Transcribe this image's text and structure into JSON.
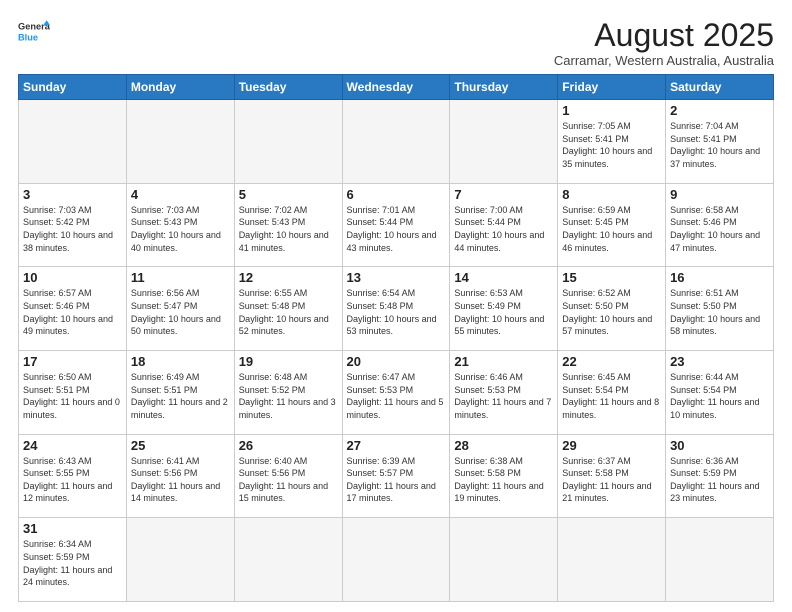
{
  "header": {
    "logo_general": "General",
    "logo_blue": "Blue",
    "month_title": "August 2025",
    "location": "Carramar, Western Australia, Australia"
  },
  "weekdays": [
    "Sunday",
    "Monday",
    "Tuesday",
    "Wednesday",
    "Thursday",
    "Friday",
    "Saturday"
  ],
  "weeks": [
    [
      {
        "day": "",
        "info": ""
      },
      {
        "day": "",
        "info": ""
      },
      {
        "day": "",
        "info": ""
      },
      {
        "day": "",
        "info": ""
      },
      {
        "day": "",
        "info": ""
      },
      {
        "day": "1",
        "info": "Sunrise: 7:05 AM\nSunset: 5:41 PM\nDaylight: 10 hours\nand 35 minutes."
      },
      {
        "day": "2",
        "info": "Sunrise: 7:04 AM\nSunset: 5:41 PM\nDaylight: 10 hours\nand 37 minutes."
      }
    ],
    [
      {
        "day": "3",
        "info": "Sunrise: 7:03 AM\nSunset: 5:42 PM\nDaylight: 10 hours\nand 38 minutes."
      },
      {
        "day": "4",
        "info": "Sunrise: 7:03 AM\nSunset: 5:43 PM\nDaylight: 10 hours\nand 40 minutes."
      },
      {
        "day": "5",
        "info": "Sunrise: 7:02 AM\nSunset: 5:43 PM\nDaylight: 10 hours\nand 41 minutes."
      },
      {
        "day": "6",
        "info": "Sunrise: 7:01 AM\nSunset: 5:44 PM\nDaylight: 10 hours\nand 43 minutes."
      },
      {
        "day": "7",
        "info": "Sunrise: 7:00 AM\nSunset: 5:44 PM\nDaylight: 10 hours\nand 44 minutes."
      },
      {
        "day": "8",
        "info": "Sunrise: 6:59 AM\nSunset: 5:45 PM\nDaylight: 10 hours\nand 46 minutes."
      },
      {
        "day": "9",
        "info": "Sunrise: 6:58 AM\nSunset: 5:46 PM\nDaylight: 10 hours\nand 47 minutes."
      }
    ],
    [
      {
        "day": "10",
        "info": "Sunrise: 6:57 AM\nSunset: 5:46 PM\nDaylight: 10 hours\nand 49 minutes."
      },
      {
        "day": "11",
        "info": "Sunrise: 6:56 AM\nSunset: 5:47 PM\nDaylight: 10 hours\nand 50 minutes."
      },
      {
        "day": "12",
        "info": "Sunrise: 6:55 AM\nSunset: 5:48 PM\nDaylight: 10 hours\nand 52 minutes."
      },
      {
        "day": "13",
        "info": "Sunrise: 6:54 AM\nSunset: 5:48 PM\nDaylight: 10 hours\nand 53 minutes."
      },
      {
        "day": "14",
        "info": "Sunrise: 6:53 AM\nSunset: 5:49 PM\nDaylight: 10 hours\nand 55 minutes."
      },
      {
        "day": "15",
        "info": "Sunrise: 6:52 AM\nSunset: 5:50 PM\nDaylight: 10 hours\nand 57 minutes."
      },
      {
        "day": "16",
        "info": "Sunrise: 6:51 AM\nSunset: 5:50 PM\nDaylight: 10 hours\nand 58 minutes."
      }
    ],
    [
      {
        "day": "17",
        "info": "Sunrise: 6:50 AM\nSunset: 5:51 PM\nDaylight: 11 hours\nand 0 minutes."
      },
      {
        "day": "18",
        "info": "Sunrise: 6:49 AM\nSunset: 5:51 PM\nDaylight: 11 hours\nand 2 minutes."
      },
      {
        "day": "19",
        "info": "Sunrise: 6:48 AM\nSunset: 5:52 PM\nDaylight: 11 hours\nand 3 minutes."
      },
      {
        "day": "20",
        "info": "Sunrise: 6:47 AM\nSunset: 5:53 PM\nDaylight: 11 hours\nand 5 minutes."
      },
      {
        "day": "21",
        "info": "Sunrise: 6:46 AM\nSunset: 5:53 PM\nDaylight: 11 hours\nand 7 minutes."
      },
      {
        "day": "22",
        "info": "Sunrise: 6:45 AM\nSunset: 5:54 PM\nDaylight: 11 hours\nand 8 minutes."
      },
      {
        "day": "23",
        "info": "Sunrise: 6:44 AM\nSunset: 5:54 PM\nDaylight: 11 hours\nand 10 minutes."
      }
    ],
    [
      {
        "day": "24",
        "info": "Sunrise: 6:43 AM\nSunset: 5:55 PM\nDaylight: 11 hours\nand 12 minutes."
      },
      {
        "day": "25",
        "info": "Sunrise: 6:41 AM\nSunset: 5:56 PM\nDaylight: 11 hours\nand 14 minutes."
      },
      {
        "day": "26",
        "info": "Sunrise: 6:40 AM\nSunset: 5:56 PM\nDaylight: 11 hours\nand 15 minutes."
      },
      {
        "day": "27",
        "info": "Sunrise: 6:39 AM\nSunset: 5:57 PM\nDaylight: 11 hours\nand 17 minutes."
      },
      {
        "day": "28",
        "info": "Sunrise: 6:38 AM\nSunset: 5:58 PM\nDaylight: 11 hours\nand 19 minutes."
      },
      {
        "day": "29",
        "info": "Sunrise: 6:37 AM\nSunset: 5:58 PM\nDaylight: 11 hours\nand 21 minutes."
      },
      {
        "day": "30",
        "info": "Sunrise: 6:36 AM\nSunset: 5:59 PM\nDaylight: 11 hours\nand 23 minutes."
      }
    ],
    [
      {
        "day": "31",
        "info": "Sunrise: 6:34 AM\nSunset: 5:59 PM\nDaylight: 11 hours\nand 24 minutes."
      },
      {
        "day": "",
        "info": ""
      },
      {
        "day": "",
        "info": ""
      },
      {
        "day": "",
        "info": ""
      },
      {
        "day": "",
        "info": ""
      },
      {
        "day": "",
        "info": ""
      },
      {
        "day": "",
        "info": ""
      }
    ]
  ]
}
